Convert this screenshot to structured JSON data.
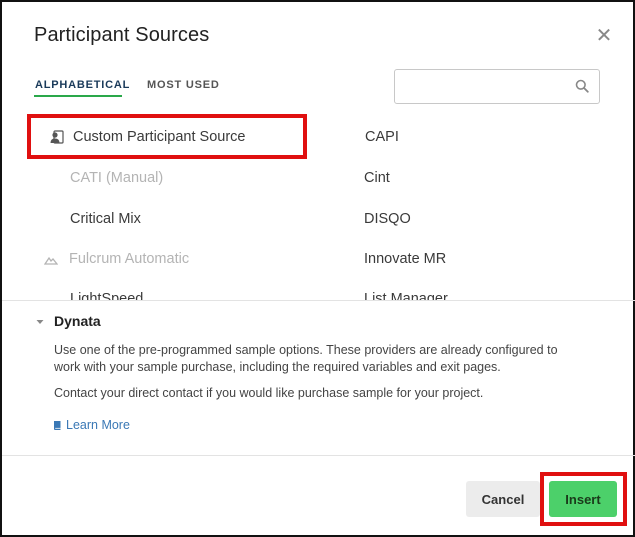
{
  "dialog": {
    "title": "Participant Sources",
    "close_icon": "close-icon"
  },
  "tabs": [
    {
      "label": "ALPHABETICAL",
      "active": true
    },
    {
      "label": "MOST USED",
      "active": false
    }
  ],
  "search": {
    "value": "",
    "placeholder": "",
    "icon": "search-icon"
  },
  "sources": {
    "left": [
      {
        "label": "Custom Participant Source",
        "icon": "person-card-icon",
        "disabled": false,
        "highlighted": true
      },
      {
        "label": "CATI (Manual)",
        "disabled": true
      },
      {
        "label": "Critical Mix",
        "disabled": false
      },
      {
        "label": "Fulcrum Automatic",
        "icon": "fulcrum-icon",
        "disabled": true
      },
      {
        "label": "LightSpeed",
        "disabled": false
      }
    ],
    "right": [
      {
        "label": "CAPI",
        "disabled": false
      },
      {
        "label": "Cint",
        "disabled": false
      },
      {
        "label": "DISQO",
        "disabled": false
      },
      {
        "label": "Innovate MR",
        "disabled": false
      },
      {
        "label": "List Manager",
        "disabled": false
      }
    ]
  },
  "details": {
    "title": "Dynata",
    "description": "Use one of the pre-programmed sample options. These providers are already configured to work with your sample purchase, including the required variables and exit pages.",
    "contact": "Contact your direct contact if you would like purchase sample for your project.",
    "learn_more": "Learn More"
  },
  "footer": {
    "cancel_label": "Cancel",
    "insert_label": "Insert"
  },
  "colors": {
    "accent_green": "#4cd06a",
    "tab_underline": "#2aa84a",
    "highlight_red": "#e01010",
    "link_blue": "#3a78b5"
  }
}
